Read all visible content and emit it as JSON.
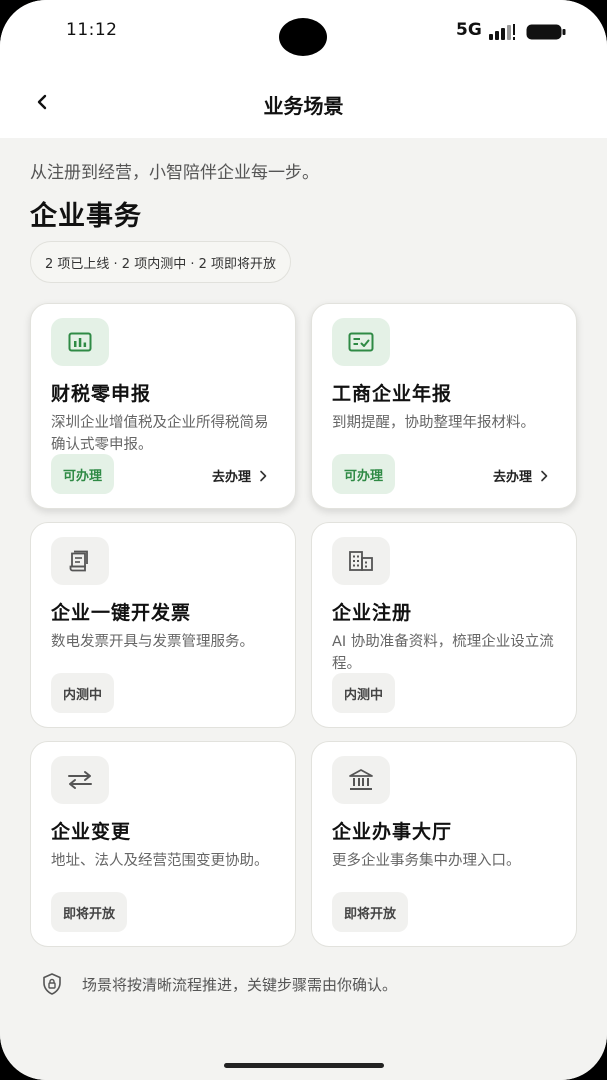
{
  "status_bar": {
    "time": "11:12",
    "network": "5G"
  },
  "nav": {
    "title": "业务场景"
  },
  "intro": {
    "subtitle": "从注册到经营，小智陪伴企业每一步。",
    "section_title": "企业事务"
  },
  "summary": {
    "text": "2 项已上线 · 2 项内测中 · 2 项即将开放"
  },
  "cards": [
    {
      "title": "财税零申报",
      "desc": "深圳企业增值税及企业所得税简易确认式零申报。",
      "badge": "可办理",
      "action": "去办理",
      "icon": "bar-chart-icon"
    },
    {
      "title": "工商企业年报",
      "desc": "到期提醒，协助整理年报材料。",
      "badge": "可办理",
      "action": "去办理",
      "icon": "report-check-icon"
    },
    {
      "title": "企业一键开发票",
      "desc": "数电发票开具与发票管理服务。",
      "badge": "内测中",
      "icon": "invoice-icon"
    },
    {
      "title": "企业注册",
      "desc": "AI 协助准备资料，梳理企业设立流程。",
      "badge": "内测中",
      "icon": "building-icon"
    },
    {
      "title": "企业变更",
      "desc": "地址、法人及经营范围变更协助。",
      "badge": "即将开放",
      "icon": "swap-arrows-icon"
    },
    {
      "title": "企业办事大厅",
      "desc": "更多企业事务集中办理入口。",
      "badge": "即将开放",
      "icon": "bank-icon"
    }
  ],
  "footer": {
    "note": "场景将按清晰流程推进，关键步骤需由你确认。"
  },
  "colors": {
    "accent_green": "#2f8a45",
    "accent_green_bg": "#e4f1e6",
    "background": "#f3f3f1"
  }
}
